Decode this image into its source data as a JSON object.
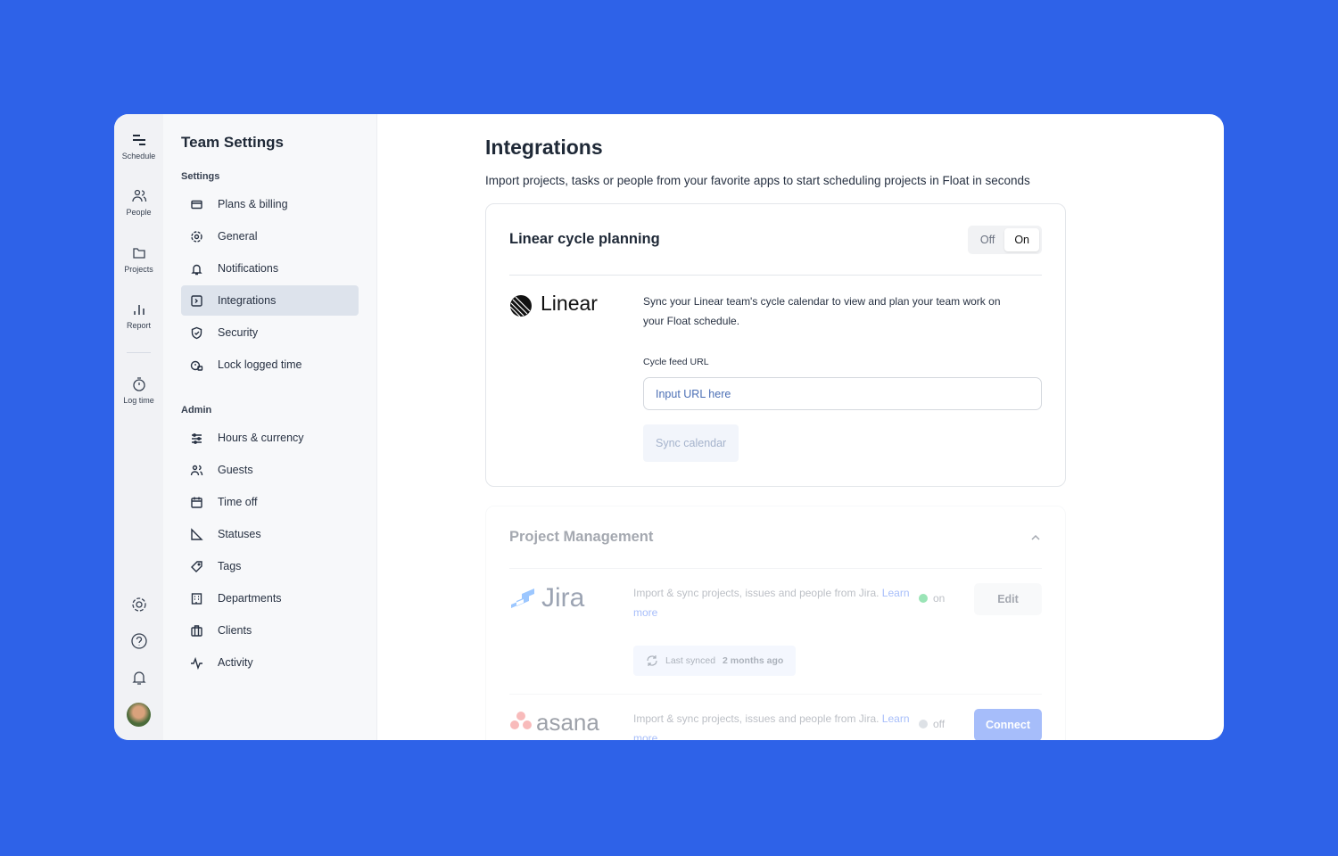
{
  "rail": {
    "items": [
      {
        "label": "Schedule",
        "icon": "schedule-icon"
      },
      {
        "label": "People",
        "icon": "people-icon"
      },
      {
        "label": "Projects",
        "icon": "folder-icon"
      },
      {
        "label": "Report",
        "icon": "bar-chart-icon"
      },
      {
        "label": "Log time",
        "icon": "stopwatch-icon"
      }
    ],
    "bottom": [
      "gear-icon",
      "help-icon",
      "bell-icon",
      "avatar"
    ]
  },
  "sidebar": {
    "title": "Team Settings",
    "settings_label": "Settings",
    "settings": [
      {
        "label": "Plans & billing"
      },
      {
        "label": "General"
      },
      {
        "label": "Notifications"
      },
      {
        "label": "Integrations",
        "active": true
      },
      {
        "label": "Security"
      },
      {
        "label": "Lock logged time"
      }
    ],
    "admin_label": "Admin",
    "admin": [
      {
        "label": "Hours & currency"
      },
      {
        "label": "Guests"
      },
      {
        "label": "Time off"
      },
      {
        "label": "Statuses"
      },
      {
        "label": "Tags"
      },
      {
        "label": "Departments"
      },
      {
        "label": "Clients"
      },
      {
        "label": "Activity"
      }
    ]
  },
  "main": {
    "title": "Integrations",
    "subtitle": "Import projects, tasks or people from your favorite apps to start scheduling projects in Float in seconds",
    "linear": {
      "title": "Linear cycle planning",
      "toggle_off": "Off",
      "toggle_on": "On",
      "toggle_value": "On",
      "logo_text": "Linear",
      "description": "Sync your Linear team's cycle calendar to view and plan your team work on your Float schedule.",
      "field_label": "Cycle feed URL",
      "placeholder": "Input URL here",
      "button": "Sync calendar"
    },
    "pm": {
      "title": "Project Management",
      "jira": {
        "logo_text": "Jira",
        "desc": "Import & sync projects, issues and people from Jira.",
        "link": "Learn more",
        "status": "on",
        "button": "Edit",
        "sync_label": "Last synced",
        "sync_value": "2 months ago"
      },
      "asana": {
        "logo_text": "asana",
        "desc": "Import & sync projects, issues and people from Jira.",
        "link": "Learn more",
        "status": "off",
        "button": "Connect"
      }
    }
  },
  "colors": {
    "background": "#2e62e8",
    "active_item": "#dde3ec",
    "status_on": "#22c55e",
    "connect": "#3b6ef5"
  }
}
